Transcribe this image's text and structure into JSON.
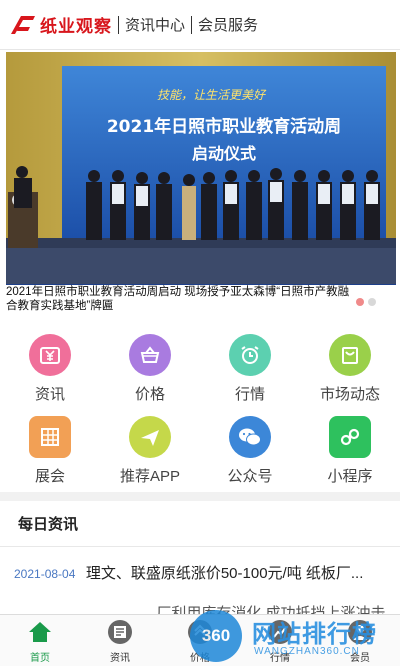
{
  "header": {
    "logo_text": "纸业观察",
    "nav": [
      "资讯中心",
      "会员服务"
    ],
    "brand_color": "#d8161c"
  },
  "banner": {
    "stage_slogan": "技能，让生活更美好",
    "stage_title": "2021年日照市职业教育活动周",
    "stage_subtitle": "启动仪式",
    "caption": "2021年日照市职业教育活动周启动 现场授予亚太森博“日照市产教融合教育实践基地”牌匾",
    "slides": 2,
    "active_slide": 1
  },
  "grid": {
    "items": [
      {
        "label": "资讯",
        "icon": "yen-icon",
        "color": "#f06f9a"
      },
      {
        "label": "价格",
        "icon": "basket-icon",
        "color": "#a97be0"
      },
      {
        "label": "行情",
        "icon": "alarm-clock-icon",
        "color": "#5cd0b0"
      },
      {
        "label": "市场动态",
        "icon": "bag-icon",
        "color": "#9ad04a"
      },
      {
        "label": "展会",
        "icon": "building-icon",
        "color": "#f2a055"
      },
      {
        "label": "推荐APP",
        "icon": "airplane-icon",
        "color": "#c5d84a"
      },
      {
        "label": "公众号",
        "icon": "wechat-icon",
        "color": "#3c87d8"
      },
      {
        "label": "小程序",
        "icon": "mini-program-icon",
        "color": "#2ec15e"
      }
    ]
  },
  "news": {
    "title": "每日资讯",
    "items": [
      {
        "date": "2021-08-04",
        "text": "理文、联盛原纸涨价50-100元/吨 纸板厂..."
      },
      {
        "date": "",
        "text": "……  …… 厂利用库存消化 成功抵挡上涨冲击"
      }
    ]
  },
  "tabbar": {
    "tabs": [
      {
        "label": "首页",
        "icon": "home-icon",
        "active": true
      },
      {
        "label": "资讯",
        "icon": "newspaper-icon",
        "active": false
      },
      {
        "label": "价格",
        "icon": "price-icon",
        "active": false
      },
      {
        "label": "行情",
        "icon": "chart-icon",
        "active": false
      },
      {
        "label": "会员",
        "icon": "person-icon",
        "active": false
      }
    ],
    "active_color": "#1a9a4a"
  },
  "watermark": {
    "badge": "360",
    "text": "网站排行榜",
    "sub": "WANGZHAN360.CN"
  }
}
